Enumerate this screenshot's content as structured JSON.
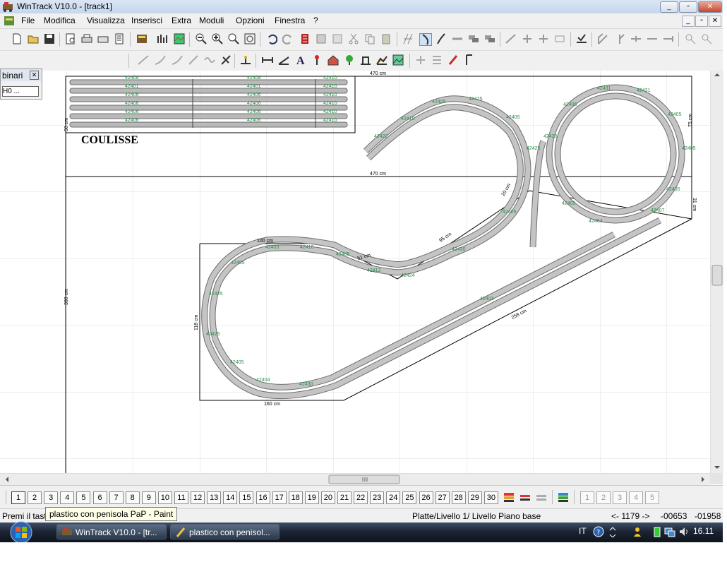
{
  "window": {
    "title": "WinTrack  V10.0 - [track1]",
    "min_glyph": "_",
    "max_glyph": "▫",
    "close_glyph": "✕"
  },
  "menu": [
    "File",
    "Modifica",
    "Visualizza",
    "Inserisci",
    "Extra",
    "Moduli",
    "Opzioni",
    "Finestra",
    "?"
  ],
  "panel": {
    "title": "binari",
    "field": "H0 ..."
  },
  "drawing": {
    "dim_top": "470 cm",
    "dim_mid": "470 cm",
    "dim_75": "75 cm",
    "dim_31": "31 cm",
    "dim_100": "100 cm",
    "dim_51": "51 cm",
    "dim_20": "20 cm",
    "dim_95": "95 cm",
    "dim_118": "118 cm",
    "dim_160": "160 cm",
    "dim_258": "258 cm",
    "dim_left": "300 cm",
    "dim_coul": "50 cm",
    "coulisse": "COULISSE",
    "codes": {
      "c42408": "42408",
      "c42410": "42410",
      "c42401": "42401",
      "c42406": "42406",
      "c42405": "42405",
      "c42425": "42425",
      "c42431": "42431",
      "c42404": "42404",
      "c42412": "42412",
      "c42403": "42403",
      "c42430": "42430",
      "c42424": "42424",
      "c42422": "42422",
      "c42407": "42407"
    }
  },
  "modules": [
    "1",
    "2",
    "3",
    "4",
    "5",
    "6",
    "7",
    "8",
    "9",
    "10",
    "11",
    "12",
    "13",
    "14",
    "15",
    "16",
    "17",
    "18",
    "19",
    "20",
    "21",
    "22",
    "23",
    "24",
    "25",
    "26",
    "27",
    "28",
    "29",
    "30"
  ],
  "module_extra": [
    "1",
    "2",
    "3",
    "4",
    "5"
  ],
  "status": {
    "left": "Premi il tast",
    "level": "Platte/Livello 1/ Livello Piano base",
    "zoom": "<- 1179 ->",
    "x": "-00653",
    "y": "-01958"
  },
  "tooltip": "plastico con penisola PaP - Paint",
  "taskbar": {
    "task1": "WinTrack  V10.0 - [tr...",
    "task2": "plastico con penisol...",
    "lang": "IT",
    "clock": "16.11"
  },
  "colors": {
    "track_fill": "#b9b9b9",
    "track_edge": "#6e6e6e",
    "label_green": "#2a8c4a",
    "grid": "#dcdcdc"
  }
}
